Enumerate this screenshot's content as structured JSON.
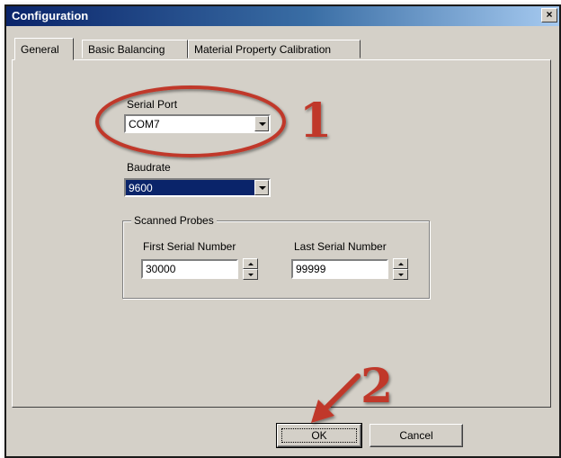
{
  "window": {
    "title": "Configuration",
    "close_label": "×"
  },
  "tabs": [
    {
      "label": "General",
      "active": true
    },
    {
      "label": "Basic Balancing",
      "active": false
    },
    {
      "label": "Material Property Calibration",
      "active": false
    }
  ],
  "general": {
    "serial_port": {
      "label": "Serial Port",
      "value": "COM7"
    },
    "baudrate": {
      "label": "Baudrate",
      "value": "9600"
    },
    "scanned_probes": {
      "legend": "Scanned Probes",
      "first": {
        "label": "First Serial Number",
        "value": "30000"
      },
      "last": {
        "label": "Last Serial Number",
        "value": "99999"
      }
    }
  },
  "buttons": {
    "ok": "OK",
    "cancel": "Cancel"
  },
  "annotations": {
    "step1": {
      "text": "1",
      "color": "#c0392b"
    },
    "step2": {
      "text": "2",
      "color": "#c0392b"
    }
  },
  "icons": {
    "dropdown": "chevron-down-icon",
    "spin_up": "spin-up-icon",
    "spin_down": "spin-down-icon",
    "close": "close-icon"
  }
}
